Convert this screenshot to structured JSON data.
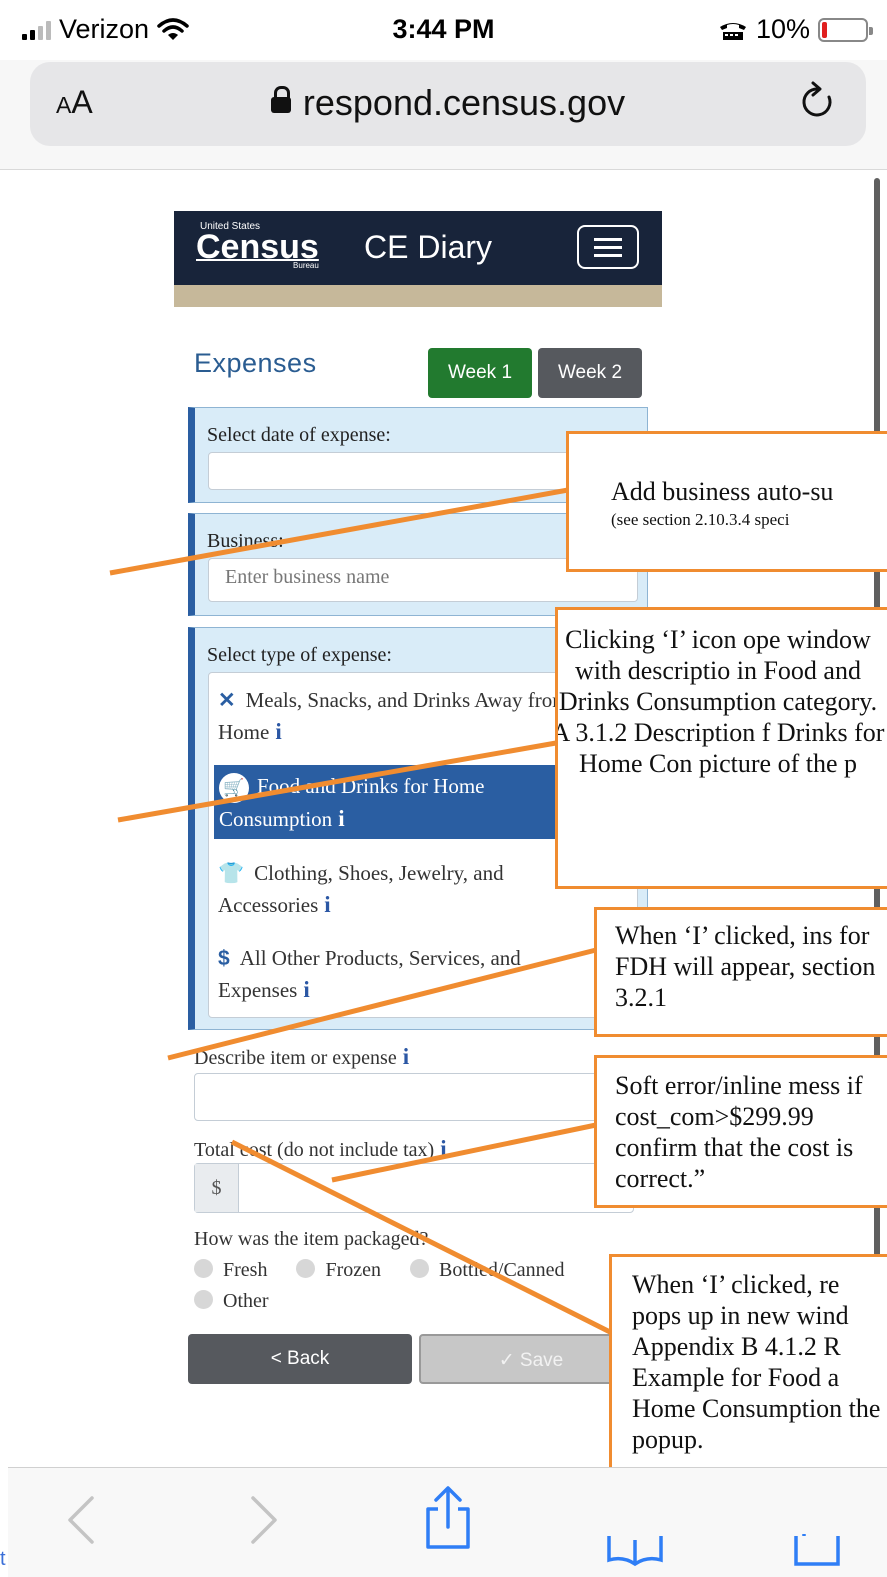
{
  "status_bar": {
    "carrier": "Verizon",
    "time": "3:44 PM",
    "battery": "10%",
    "battery_level": 0.1
  },
  "browser": {
    "text_size_label_small": "A",
    "text_size_label_large": "A",
    "url": "respond.census.gov"
  },
  "app": {
    "logo_top": "United States",
    "logo_main": "Census",
    "logo_bottom": "Bureau",
    "title": "CE Diary"
  },
  "form": {
    "heading": "Expenses",
    "week1_label": "Week 1",
    "week2_label": "Week 2",
    "date_label": "Select date of expense:",
    "business_label": "Business:",
    "business_placeholder": "Enter business name",
    "type_label": "Select type of expense:",
    "expense_types": [
      {
        "label_line1": "Meals, Snacks, and Drinks Away from",
        "label_line2": "Home",
        "icon": "fork-knife-icon",
        "selected": false
      },
      {
        "label_line1": "Food and Drinks for Home",
        "label_line2": "Consumption",
        "icon": "shopping-cart-icon",
        "selected": true
      },
      {
        "label_line1": "Clothing, Shoes, Jewelry, and",
        "label_line2": "Accessories",
        "icon": "tshirt-icon",
        "selected": false
      },
      {
        "label_line1": "All Other Products, Services, and",
        "label_line2": "Expenses",
        "icon": "dollar-icon",
        "selected": false
      }
    ],
    "info_glyph": "i",
    "describe_label": "Describe item or expense",
    "cost_label": "Total cost (do not include tax)",
    "currency_symbol": "$",
    "packaging_question": "How was the item packaged?",
    "packaging_options": [
      "Fresh",
      "Frozen",
      "Bottled/Canned",
      "Other"
    ],
    "back_label": "< Back",
    "save_label": "✓ Save"
  },
  "annotations": [
    {
      "line1": "Add business auto-su",
      "line2": "(see section 2.10.3.4 speci"
    },
    {
      "text": "Clicking ‘I’ icon ope window with descriptio in Food and Drinks Consumption category. A 3.1.2 Description f Drinks for Home Con picture of the p"
    },
    {
      "text": "When ‘I’ clicked, ins for FDH will appear, section 3.2.1"
    },
    {
      "text": "Soft error/inline mess if cost_com>$299.99 confirm that the cost is correct.”"
    },
    {
      "text": "When ‘I’ clicked, re pops up in new wind Appendix B 4.1.2 R Example for Food a Home Consumption the popup."
    }
  ],
  "edge_text": "t",
  "colors": {
    "annotation_border": "#f08c30",
    "header_bg": "#18243a",
    "week1_bg": "#227a2f",
    "selected_bg": "#2a5ea2"
  }
}
